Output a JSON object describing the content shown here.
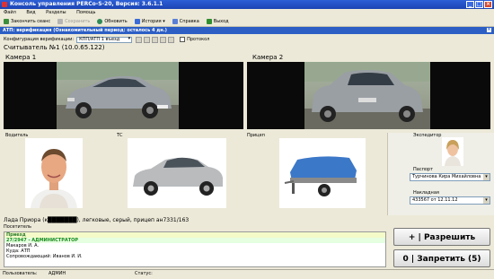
{
  "window": {
    "title": "Консоль управления PERCo-S-20, Версия: 3.6.1.1"
  },
  "menu": [
    "Файл",
    "Вид",
    "Разделы",
    "Помощь"
  ],
  "toolbar": {
    "items": [
      {
        "label": "Закончить сеанс",
        "enabled": true
      },
      {
        "label": "Сохранить",
        "enabled": false
      },
      {
        "label": "Обновить",
        "enabled": true
      },
      {
        "label": "История",
        "enabled": true
      },
      {
        "label": "Справка",
        "enabled": true
      },
      {
        "label": "Выход",
        "enabled": true
      }
    ]
  },
  "banner": {
    "text": "АТП: верификация (Ознакомительный период: осталось 4 дн.)"
  },
  "config": {
    "label": "Конфигурация верификации:",
    "value": "КПП/АТП 1 въезд",
    "checkbox_label": "Протокол"
  },
  "reader": {
    "title": "Считыватель №1 (10.0.65.122)"
  },
  "cameras": [
    {
      "label": "Камера 1"
    },
    {
      "label": "Камера 2"
    }
  ],
  "sections": {
    "driver": "Водитель",
    "vehicle": "ТС",
    "trailer": "Прицеп",
    "expeditor": "Экспедитор"
  },
  "expander": {
    "passport_label": "Паспорт",
    "passport_value": "Турчинова Кира Михайловна",
    "invoice_label": "Накладная",
    "invoice_value": "433567 от 12.11.12"
  },
  "description": "Лада Приора (к███████), легковые, серый, прицеп ан7331/163",
  "visitor": {
    "label": "Посетитель",
    "lines": [
      "Приезд",
      "27/2947 - АДМИНИСТРАТОР",
      "Макаров И. А.",
      "Куда: АТП",
      "Сопровождающий: Иванов И. И."
    ]
  },
  "buttons": {
    "allow": "+ | Разрешить",
    "deny": "0 | Запретить (5)"
  },
  "status": {
    "user_label": "Пользователь:",
    "user_value": "АДМИН",
    "status_label": "Статус:"
  },
  "colors": {
    "title": "#1b44b4",
    "banner": "#2c5ec4",
    "visitor_row1": "#f4fbc8",
    "visitor_row2": "#e5ffe0"
  }
}
